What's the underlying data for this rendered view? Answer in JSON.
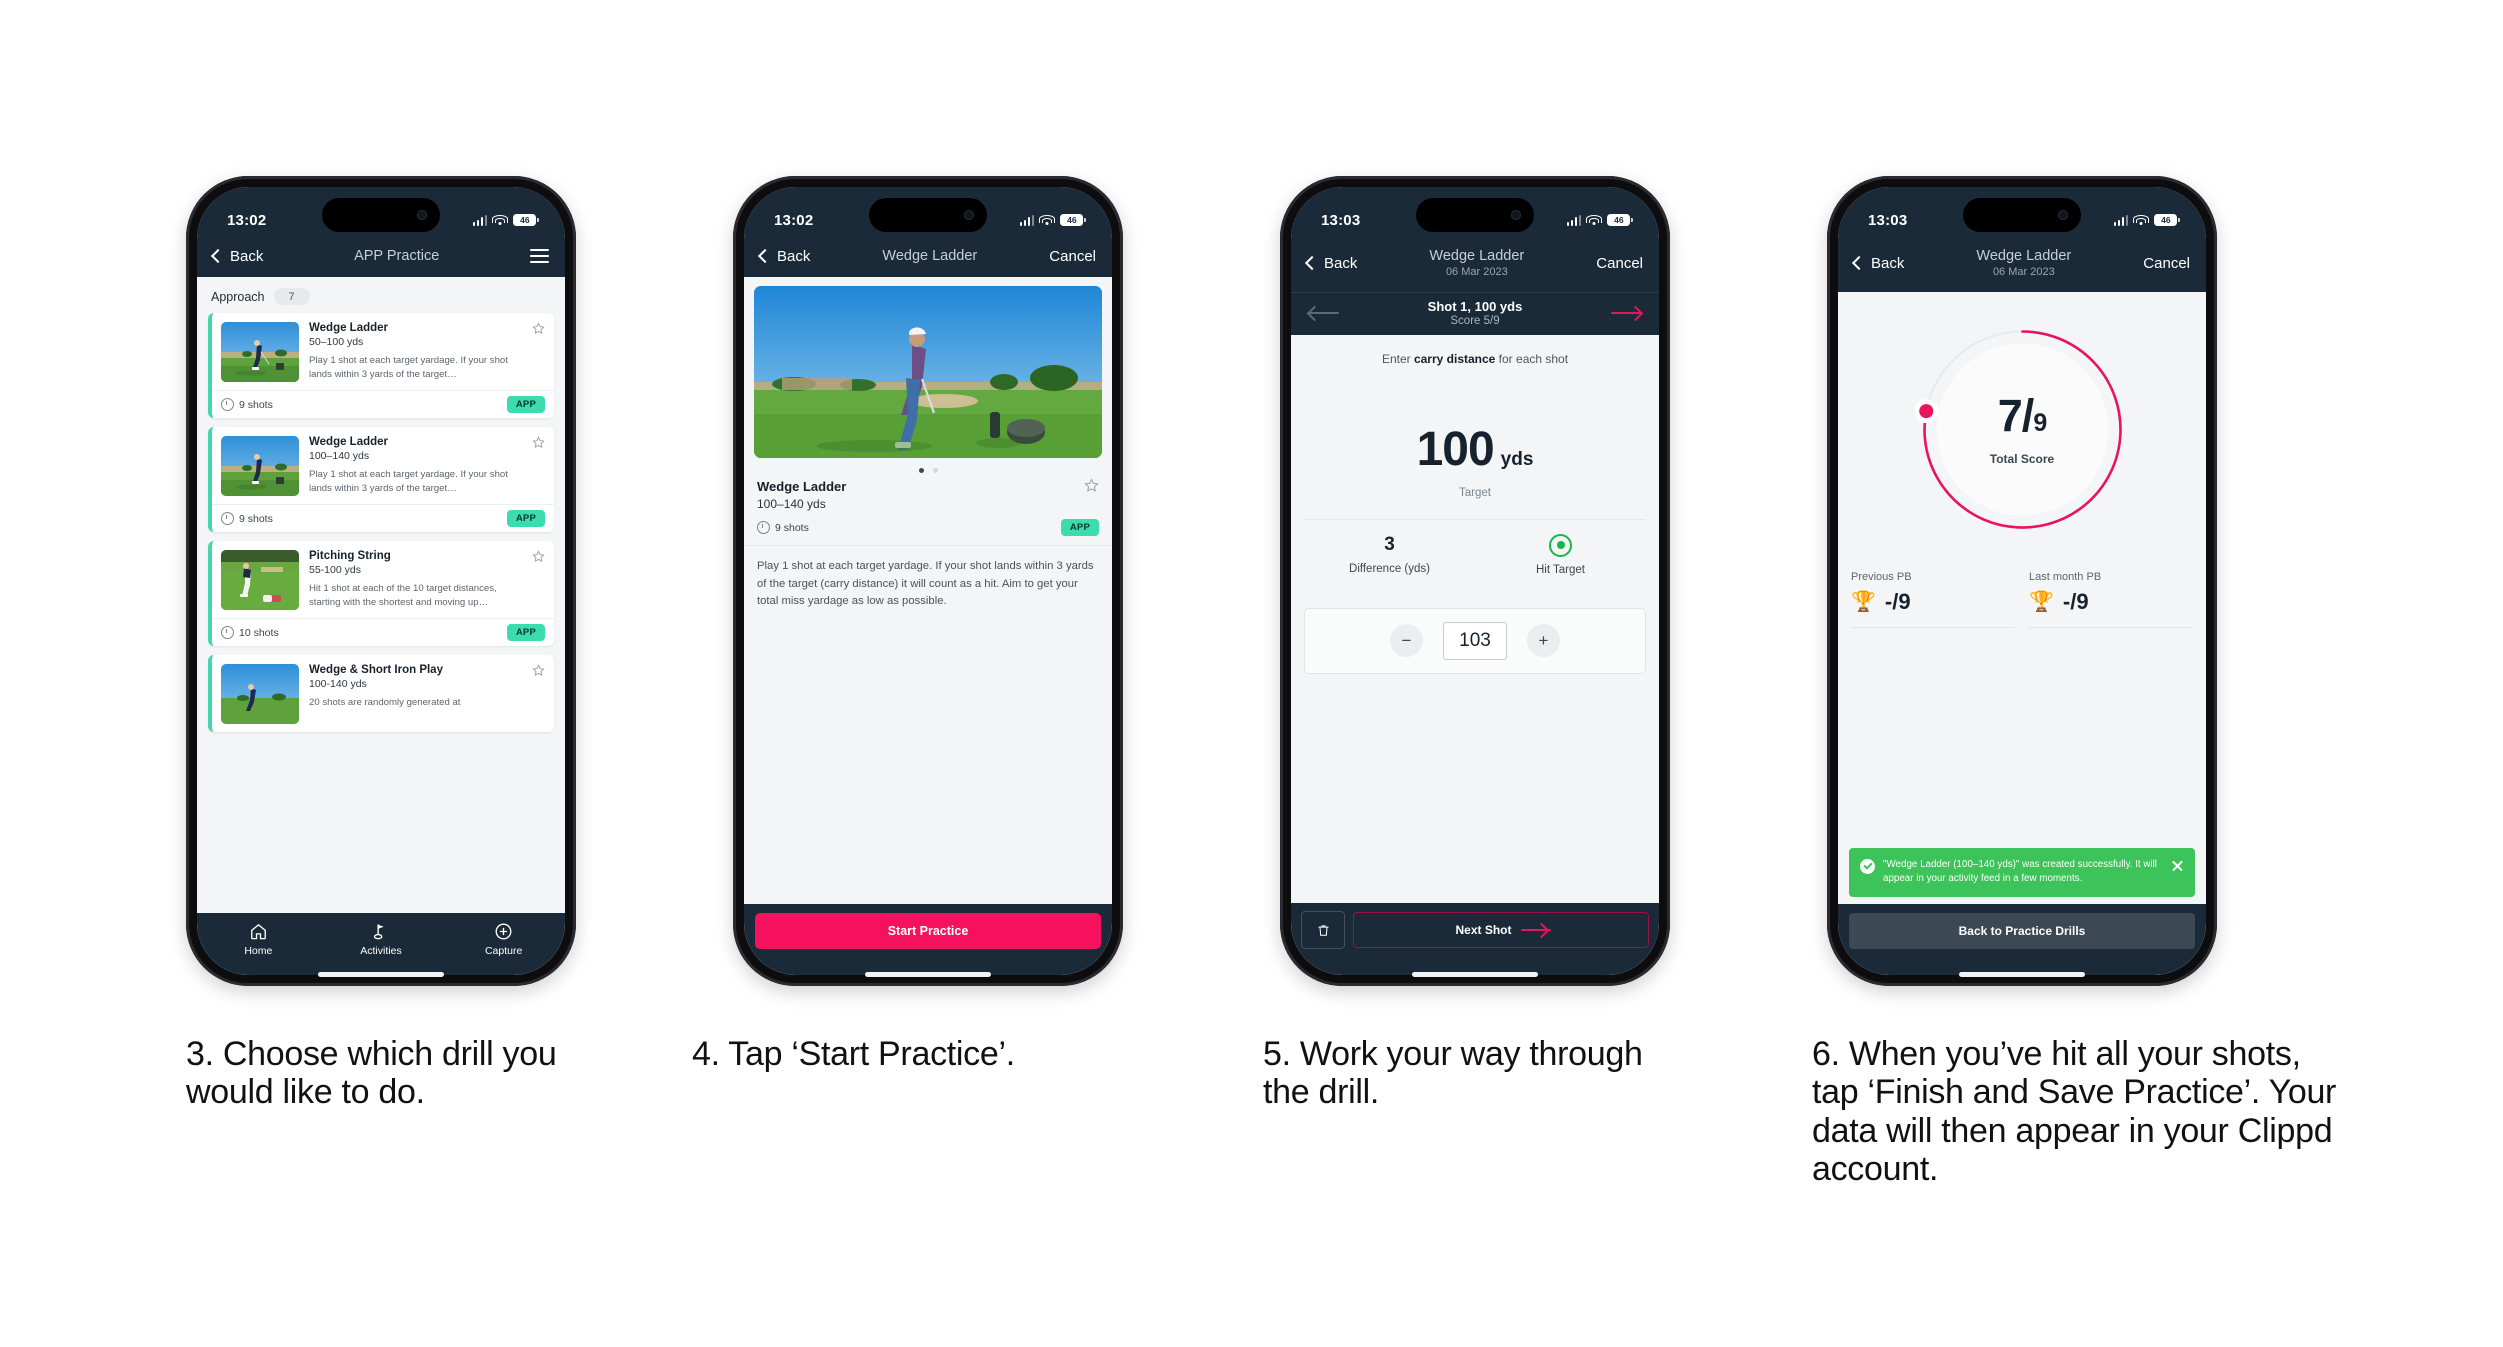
{
  "phones": [
    {
      "id": "phone-drill-list",
      "status": {
        "time": "13:02",
        "battery": "46"
      },
      "nav": {
        "back": "Back",
        "title": "APP Practice"
      },
      "category": {
        "label": "Approach",
        "count": "7"
      },
      "drills": [
        {
          "title": "Wedge Ladder",
          "yards": "50–100 yds",
          "desc": "Play 1 shot at each target yardage. If your shot lands within 3 yards of the target…",
          "shots": "9 shots",
          "badge": "APP"
        },
        {
          "title": "Wedge Ladder",
          "yards": "100–140 yds",
          "desc": "Play 1 shot at each target yardage. If your shot lands within 3 yards of the target…",
          "shots": "9 shots",
          "badge": "APP"
        },
        {
          "title": "Pitching String",
          "yards": "55-100 yds",
          "desc": "Hit 1 shot at each of the 10 target distances, starting with the shortest and moving up…",
          "shots": "10 shots",
          "badge": "APP"
        },
        {
          "title": "Wedge & Short Iron Play",
          "yards": "100-140 yds",
          "desc": "20 shots are randomly generated at",
          "shots": "",
          "badge": ""
        }
      ],
      "tabs": [
        {
          "label": "Home",
          "icon": "home-icon"
        },
        {
          "label": "Activities",
          "icon": "golf-flag-icon"
        },
        {
          "label": "Capture",
          "icon": "plus-circle-icon"
        }
      ]
    },
    {
      "id": "phone-drill-detail",
      "status": {
        "time": "13:02",
        "battery": "46"
      },
      "nav": {
        "back": "Back",
        "title": "Wedge Ladder",
        "cancel": "Cancel"
      },
      "detail": {
        "title": "Wedge Ladder",
        "yards": "100–140 yds",
        "shots": "9 shots",
        "badge": "APP",
        "description": "Play 1 shot at each target yardage. If your shot lands within 3 yards of the target (carry distance) it will count as a hit. Aim to get your total miss yardage as low as possible."
      },
      "cta": "Start Practice"
    },
    {
      "id": "phone-shot-entry",
      "status": {
        "time": "13:03",
        "battery": "46"
      },
      "nav": {
        "back": "Back",
        "title": "Wedge Ladder",
        "subtitle": "06 Mar 2023",
        "cancel": "Cancel"
      },
      "shotbar": {
        "title": "Shot 1, 100 yds",
        "score": "Score 5/9"
      },
      "hint_pre": "Enter ",
      "hint_bold": "carry distance",
      "hint_post": " for each shot",
      "target": {
        "value": "100",
        "unit": "yds",
        "label": "Target"
      },
      "stats": [
        {
          "value": "3",
          "label": "Difference (yds)"
        },
        {
          "value": "",
          "label": "Hit Target"
        }
      ],
      "stepper": {
        "minus": "−",
        "value": "103",
        "plus": "+"
      },
      "footer": {
        "delete_icon": "trash-icon",
        "next": "Next Shot"
      }
    },
    {
      "id": "phone-result",
      "status": {
        "time": "13:03",
        "battery": "46"
      },
      "nav": {
        "back": "Back",
        "title": "Wedge Ladder",
        "subtitle": "06 Mar 2023",
        "cancel": "Cancel"
      },
      "result": {
        "score": "7",
        "divider": "/",
        "denominator": "9",
        "label": "Total Score",
        "percent": 78
      },
      "pbs": [
        {
          "label": "Previous PB",
          "value": "-/9",
          "icon": "trophy-icon"
        },
        {
          "label": "Last month PB",
          "value": "-/9",
          "icon": "trophy-icon"
        }
      ],
      "toast": {
        "message": "\"Wedge Ladder (100–140 yds)\" was created successfully. It will appear in your activity feed in a few moments."
      },
      "footer": {
        "back_label": "Back to Practice Drills"
      }
    }
  ],
  "captions": [
    "3. Choose which drill you would like to do.",
    "4. Tap ‘Start Practice’.",
    "5. Work your way through the drill.",
    "6. When you’ve hit all your shots, tap ‘Finish and Save Practice’. Your data will then appear in your Clippd account."
  ],
  "colors": {
    "navy": "#1b2a38",
    "pink": "#f5115e",
    "mint": "#3ddcae",
    "green": "#3cc359",
    "page_bg": "#ffffff"
  }
}
